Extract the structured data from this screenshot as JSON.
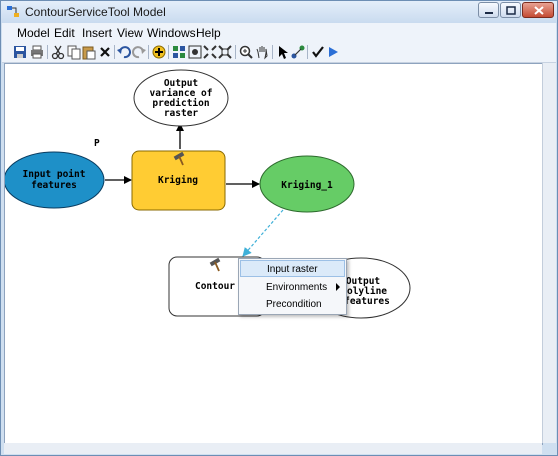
{
  "window": {
    "title": "ContourServiceTool Model"
  },
  "menu": [
    "Model",
    "Edit",
    "Insert",
    "View",
    "Windows",
    "Help"
  ],
  "diagram": {
    "nodes": {
      "input_points": {
        "lines": [
          "Input point",
          "features"
        ],
        "fill": "#1e90c8"
      },
      "kriging": {
        "lines": [
          "Kriging"
        ],
        "fill": "#ffcc33"
      },
      "kriging_out": {
        "lines": [
          "Kriging_1"
        ],
        "fill": "#66cc66"
      },
      "variance_out": {
        "lines": [
          "Output",
          "variance of",
          "prediction",
          "raster"
        ]
      },
      "contour": {
        "lines": [
          "Contour"
        ]
      },
      "output_polyline": {
        "lines": [
          "Output",
          "olyline",
          "features"
        ]
      }
    },
    "parameter_marker": "P"
  },
  "context_menu": {
    "items": [
      {
        "label": "Input raster",
        "highlighted": true
      },
      {
        "label": "Environments",
        "submenu": true
      },
      {
        "label": "Precondition"
      }
    ]
  }
}
